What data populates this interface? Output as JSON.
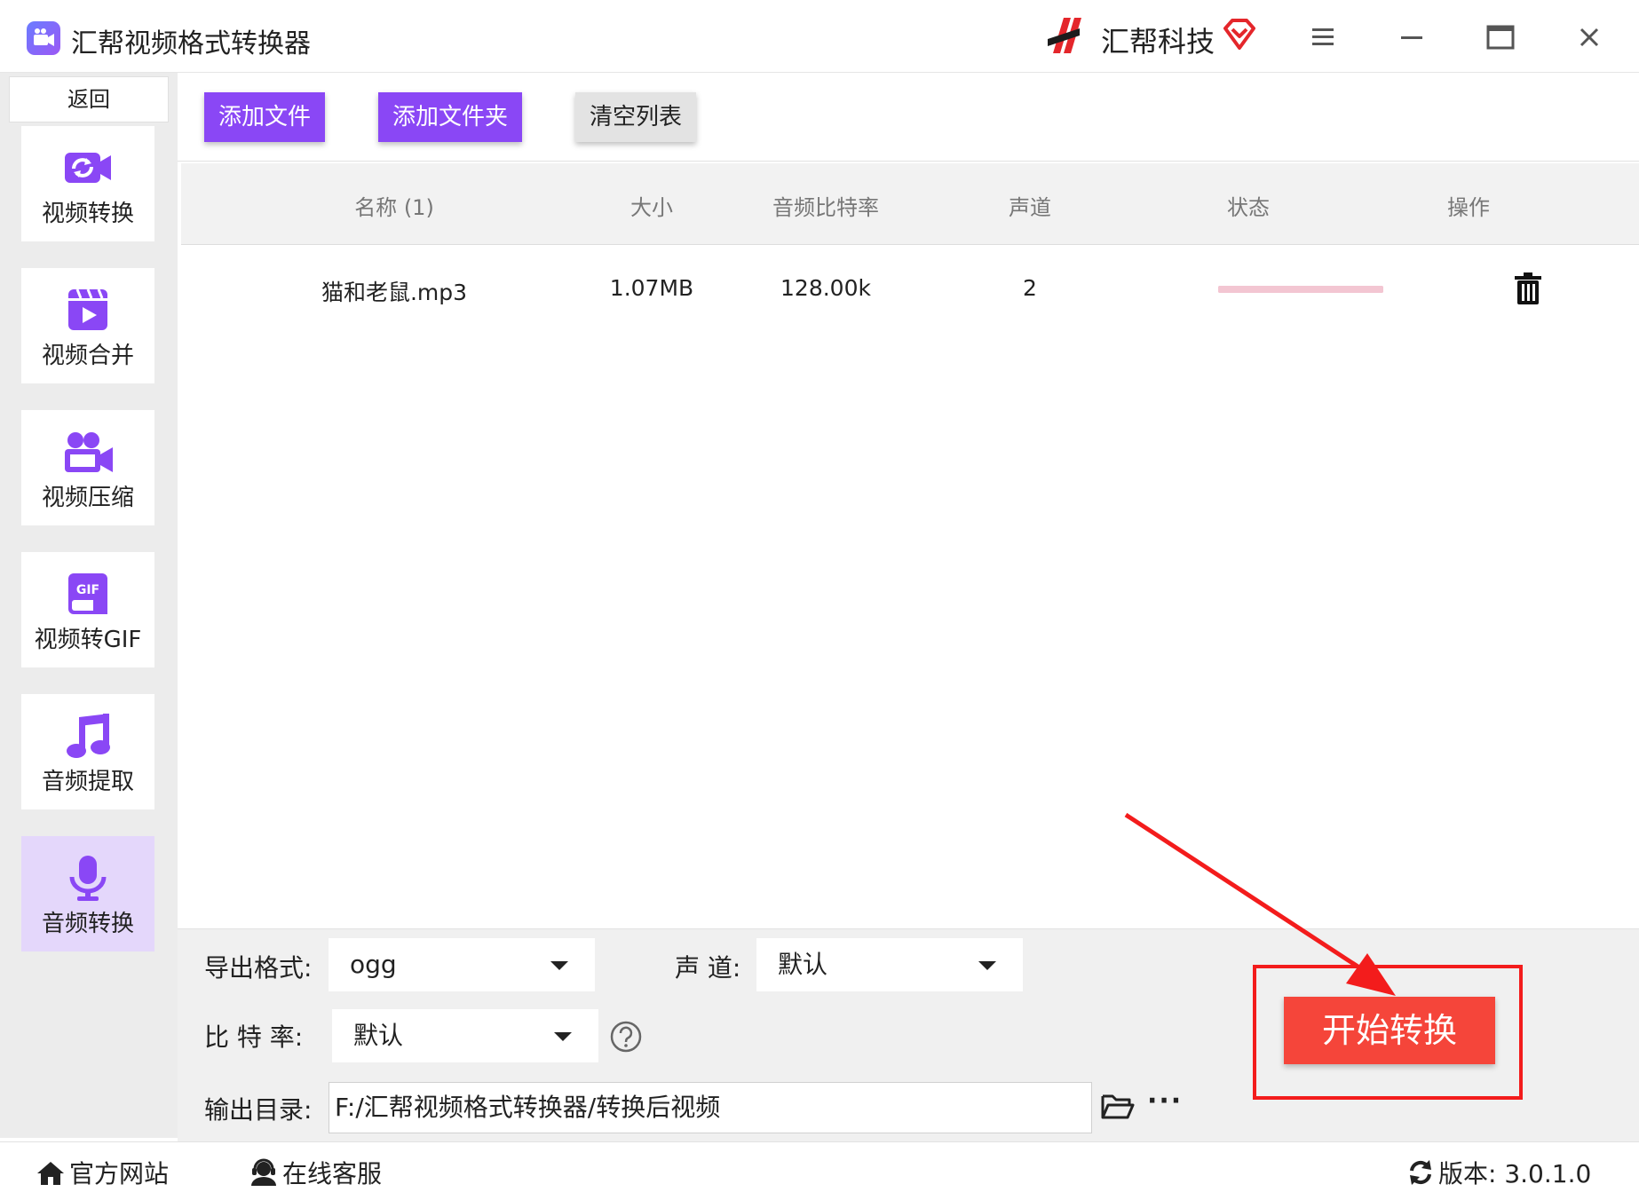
{
  "window": {
    "title": "汇帮视频格式转换器",
    "brand": "汇帮科技"
  },
  "sidebar": {
    "back_label": "返回",
    "items": [
      {
        "label": "视频转换",
        "icon": "video-convert-icon"
      },
      {
        "label": "视频合并",
        "icon": "video-merge-icon"
      },
      {
        "label": "视频压缩",
        "icon": "video-compress-icon"
      },
      {
        "label": "视频转GIF",
        "icon": "gif-icon"
      },
      {
        "label": "音频提取",
        "icon": "music-note-icon"
      },
      {
        "label": "音频转换",
        "icon": "microphone-icon",
        "active": true
      }
    ]
  },
  "toolbar": {
    "add_file": "添加文件",
    "add_folder": "添加文件夹",
    "clear_list": "清空列表"
  },
  "table": {
    "headers": [
      "名称 (1)",
      "大小",
      "音频比特率",
      "声道",
      "状态",
      "操作"
    ],
    "rows": [
      {
        "name": "猫和老鼠.mp3",
        "size": "1.07MB",
        "bitrate": "128.00k",
        "channels": "2",
        "status_progress": 1.0
      }
    ]
  },
  "settings": {
    "format_label": "导出格式:",
    "format_value": "ogg",
    "channel_label": "声 道:",
    "channel_value": "默认",
    "bitrate_label": "比 特 率:",
    "bitrate_value": "默认",
    "output_label": "输出目录:",
    "output_value": "F:/汇帮视频格式转换器/转换后视频",
    "more_label": "···",
    "start_label": "开始转换"
  },
  "footer": {
    "website": "官方网站",
    "support": "在线客服",
    "version": "版本: 3.0.1.0"
  },
  "colors": {
    "accent": "#8a47f5",
    "start_button": "#f5453a",
    "annotation": "#f31c1c",
    "progress": "#f3c6d2"
  }
}
